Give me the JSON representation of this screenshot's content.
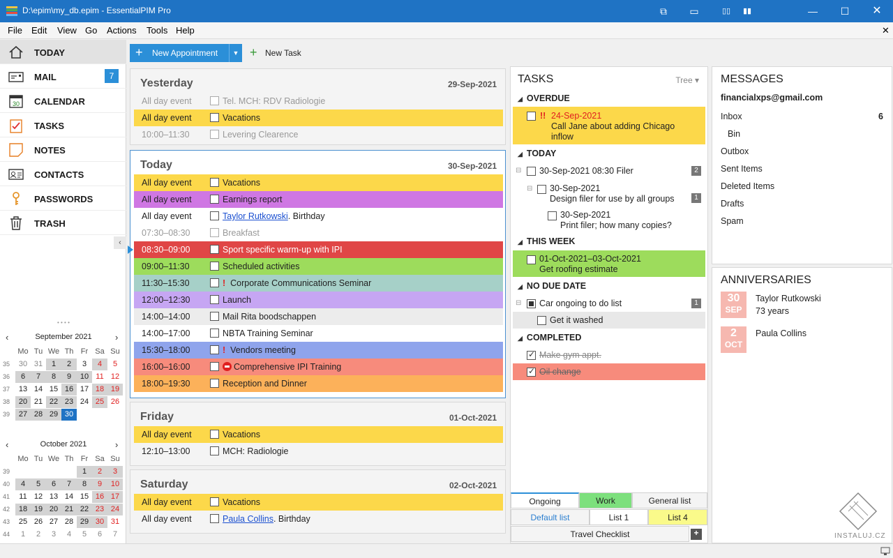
{
  "window": {
    "title": "D:\\epim\\my_db.epim - EssentialPIM Pro"
  },
  "menu": [
    "File",
    "Edit",
    "View",
    "Go",
    "Actions",
    "Tools",
    "Help"
  ],
  "nav": [
    {
      "label": "TODAY",
      "icon": "home-icon"
    },
    {
      "label": "MAIL",
      "icon": "mail-icon",
      "badge": "7"
    },
    {
      "label": "CALENDAR",
      "icon": "calendar-icon"
    },
    {
      "label": "TASKS",
      "icon": "tasks-clipboard-icon"
    },
    {
      "label": "NOTES",
      "icon": "note-icon"
    },
    {
      "label": "CONTACTS",
      "icon": "contact-card-icon"
    },
    {
      "label": "PASSWORDS",
      "icon": "key-icon"
    },
    {
      "label": "TRASH",
      "icon": "trash-icon"
    }
  ],
  "mini_calendars": [
    {
      "title": "September  2021",
      "headers": [
        "Mo",
        "Tu",
        "We",
        "Th",
        "Fr",
        "Sa",
        "Su"
      ],
      "weeks": [
        {
          "wn": "35",
          "days": [
            "30",
            "31",
            "1",
            "2",
            "3",
            "4",
            "5"
          ]
        },
        {
          "wn": "36",
          "days": [
            "6",
            "7",
            "8",
            "9",
            "10",
            "11",
            "12"
          ]
        },
        {
          "wn": "37",
          "days": [
            "13",
            "14",
            "15",
            "16",
            "17",
            "18",
            "19"
          ]
        },
        {
          "wn": "38",
          "days": [
            "20",
            "21",
            "22",
            "23",
            "24",
            "25",
            "26"
          ]
        },
        {
          "wn": "39",
          "days": [
            "27",
            "28",
            "29",
            "30",
            "",
            "",
            ""
          ]
        }
      ]
    },
    {
      "title": "October  2021",
      "headers": [
        "Mo",
        "Tu",
        "We",
        "Th",
        "Fr",
        "Sa",
        "Su"
      ],
      "weeks": [
        {
          "wn": "39",
          "days": [
            "",
            "",
            "",
            "",
            "1",
            "2",
            "3"
          ]
        },
        {
          "wn": "40",
          "days": [
            "4",
            "5",
            "6",
            "7",
            "8",
            "9",
            "10"
          ]
        },
        {
          "wn": "41",
          "days": [
            "11",
            "12",
            "13",
            "14",
            "15",
            "16",
            "17"
          ]
        },
        {
          "wn": "42",
          "days": [
            "18",
            "19",
            "20",
            "21",
            "22",
            "23",
            "24"
          ]
        },
        {
          "wn": "43",
          "days": [
            "25",
            "26",
            "27",
            "28",
            "29",
            "30",
            "31"
          ]
        },
        {
          "wn": "44",
          "days": [
            "1",
            "2",
            "3",
            "4",
            "5",
            "6",
            "7"
          ]
        }
      ]
    }
  ],
  "toolbar": {
    "new_appointment": "New Appointment",
    "new_task": "New Task"
  },
  "days": [
    {
      "title": "Yesterday",
      "date": "29-Sep-2021",
      "events": [
        {
          "time": "All day event",
          "subject": "Tel. MCH: RDV Radiologie",
          "color": "",
          "dim": true
        },
        {
          "time": "All day event",
          "subject": "Vacations",
          "color": "#fcd84a"
        },
        {
          "time": "10:00–11:30",
          "subject": "Levering Clearence",
          "color": "",
          "dim": true
        }
      ]
    },
    {
      "title": "Today",
      "date": "30-Sep-2021",
      "events": [
        {
          "time": "All day event",
          "subject": "Vacations",
          "color": "#fcd84a"
        },
        {
          "time": "All day event",
          "subject": "Earnings report",
          "color": "#cf77e3"
        },
        {
          "time": "All day event",
          "subject_link": "Taylor Rutkowski",
          "subject": ". Birthday",
          "color": ""
        },
        {
          "time": "07:30–08:30",
          "subject": "Breakfast",
          "color": "",
          "dim": true
        },
        {
          "time": "08:30–09:00",
          "subject": "Sport specific warm-up with IPI",
          "color": "#e04646",
          "white": true
        },
        {
          "time": "09:00–11:30",
          "subject": "Scheduled activities",
          "color": "#9ddc5c"
        },
        {
          "time": "11:30–15:30",
          "subject": "Corporate Communications Seminar",
          "color": "#a6d0c8",
          "excl": "!"
        },
        {
          "time": "12:00–12:30",
          "subject": "Launch",
          "color": "#c6a6f3"
        },
        {
          "time": "14:00–14:00",
          "subject": "Mail Rita boodschappen",
          "color": "#ececec"
        },
        {
          "time": "14:00–17:00",
          "subject": "NBTA Training Seminar",
          "color": ""
        },
        {
          "time": "15:30–18:00",
          "subject": "Vendors meeting",
          "color": "#8fa4ec",
          "excl": "!"
        },
        {
          "time": "16:00–16:00",
          "subject": "Comprehensive IPI Training",
          "color": "#f78b7c",
          "noentry": true
        },
        {
          "time": "18:00–19:30",
          "subject": "Reception and Dinner",
          "color": "#fcb15a"
        }
      ]
    },
    {
      "title": "Friday",
      "date": "01-Oct-2021",
      "events": [
        {
          "time": "All day event",
          "subject": "Vacations",
          "color": "#fcd84a"
        },
        {
          "time": "12:10–13:00",
          "subject": "MCH: Radiologie",
          "color": ""
        }
      ]
    },
    {
      "title": "Saturday",
      "date": "02-Oct-2021",
      "events": [
        {
          "time": "All day event",
          "subject": "Vacations",
          "color": "#fcd84a"
        },
        {
          "time": "All day event",
          "subject_link": "Paula Collins",
          "subject": ". Birthday",
          "color": ""
        }
      ]
    }
  ],
  "tasks": {
    "title": "TASKS",
    "view": "Tree",
    "sections": {
      "overdue": "OVERDUE",
      "today": "TODAY",
      "this_week": "THIS WEEK",
      "no_due": "NO DUE DATE",
      "completed": "COMPLETED"
    },
    "overdue": {
      "priority": "!!",
      "date": "24-Sep-2021",
      "line1": "Call Jane about adding Chicago",
      "line2": "inflow"
    },
    "today": [
      {
        "text": "30-Sep-2021 08:30 Filer",
        "count": "2"
      },
      {
        "date": "30-Sep-2021",
        "text": "Design filer for use by all groups",
        "count": "1"
      },
      {
        "date": "30-Sep-2021",
        "text": "Print filer; how many copies?"
      }
    ],
    "this_week": {
      "date": "01-Oct-2021–03-Oct-2021",
      "text": "Get roofing estimate"
    },
    "no_due": [
      {
        "text": "Car ongoing to do list",
        "count": "1"
      },
      {
        "text": "Get it washed"
      }
    ],
    "completed": [
      {
        "text": "Make gym appt."
      },
      {
        "text": "Oil change"
      }
    ],
    "tabs_row1": [
      "Ongoing",
      "Work",
      "General list"
    ],
    "tabs_row2": [
      "Default list",
      "List 1",
      "List 4"
    ],
    "tabs_row3": [
      "Travel Checklist"
    ]
  },
  "messages": {
    "title": "MESSAGES",
    "account": "financialxps@gmail.com",
    "folders": [
      {
        "name": "Inbox",
        "count": "6"
      },
      {
        "name": "Bin"
      },
      {
        "name": "Outbox"
      },
      {
        "name": "Sent Items"
      },
      {
        "name": "Deleted Items"
      },
      {
        "name": "Drafts"
      },
      {
        "name": "Spam"
      }
    ]
  },
  "anniversaries": {
    "title": "ANNIVERSARIES",
    "items": [
      {
        "day": "30",
        "month": "SEP",
        "name": "Taylor Rutkowski",
        "detail": "73 years"
      },
      {
        "day": "2",
        "month": "OCT",
        "name": "Paula Collins",
        "detail": ""
      }
    ]
  },
  "watermark": "INSTALUJ.CZ"
}
